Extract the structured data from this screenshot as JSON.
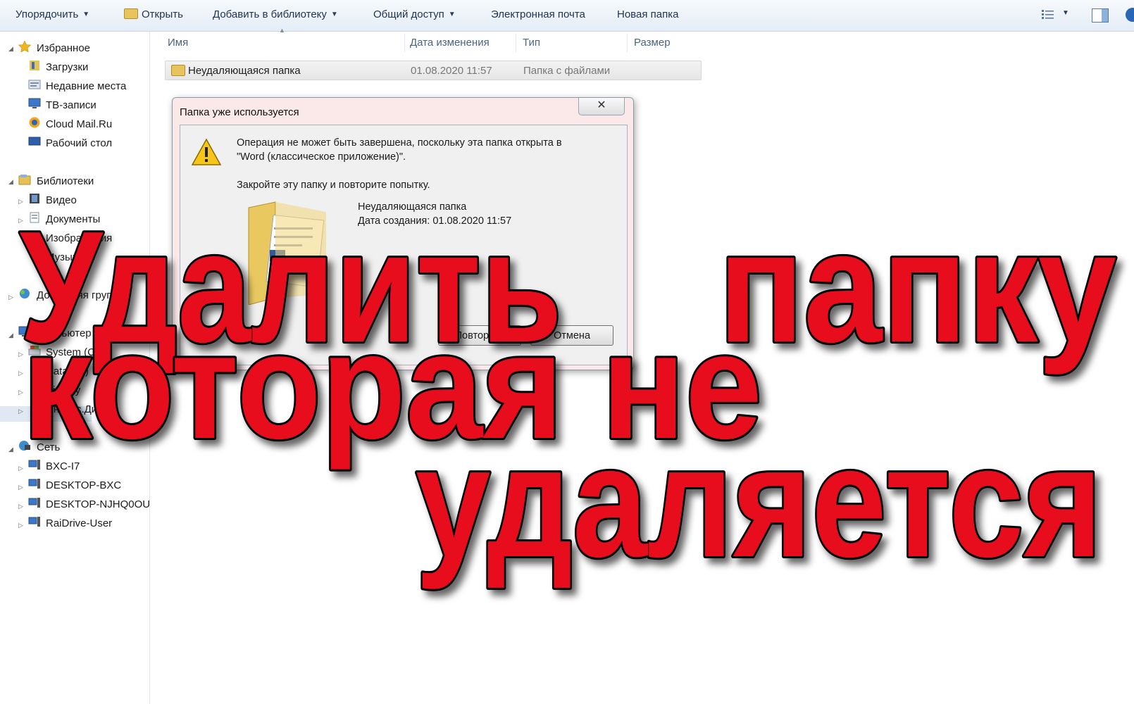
{
  "toolbar": {
    "organize": "Упорядочить",
    "open": "Открыть",
    "add_to_library": "Добавить в библиотеку",
    "share": "Общий доступ",
    "email": "Электронная почта",
    "new_folder": "Новая папка"
  },
  "nav": {
    "favorites": {
      "label": "Избранное",
      "items": [
        "Загрузки",
        "Недавние места",
        "ТВ-записи",
        "Cloud Mail.Ru",
        "Рабочий стол"
      ]
    },
    "libraries": {
      "label": "Библиотеки",
      "items": [
        "Видео",
        "Документы",
        "Изображения",
        "Музыка"
      ]
    },
    "homegroup": "Домашняя группа",
    "computer": {
      "label": "Компьютер",
      "items": [
        "System (C:)",
        "Data (D:)",
        "Biology",
        "Яндекс.Диск"
      ]
    },
    "network": {
      "label": "Сеть",
      "items": [
        "BXC-I7",
        "DESKTOP-BXC",
        "DESKTOP-NJHQ0OU",
        "RaiDrive-User"
      ]
    }
  },
  "columns": {
    "name": "Имя",
    "date": "Дата изменения",
    "type": "Тип",
    "size": "Размер"
  },
  "files": [
    {
      "name": "Неудаляющаяся папка",
      "date": "01.08.2020 11:57",
      "type": "Папка с файлами"
    }
  ],
  "dialog": {
    "title": "Папка уже используется",
    "close_glyph": "✕",
    "message_line1": "Операция не может быть завершена, поскольку эта папка открыта в",
    "message_line2": "\"Word (классическое приложение)\".",
    "message_2": "Закройте эту папку и повторите попытку.",
    "item_name": "Неудаляющаяся папка",
    "item_created": "Дата создания: 01.08.2020 11:57",
    "retry": "Повторить",
    "cancel": "Отмена"
  },
  "overlay": {
    "line1_word1": "Удалить",
    "line1_word2": "папку",
    "line2": "которая не",
    "line3": "удаляется",
    "color": "#e8101e"
  }
}
